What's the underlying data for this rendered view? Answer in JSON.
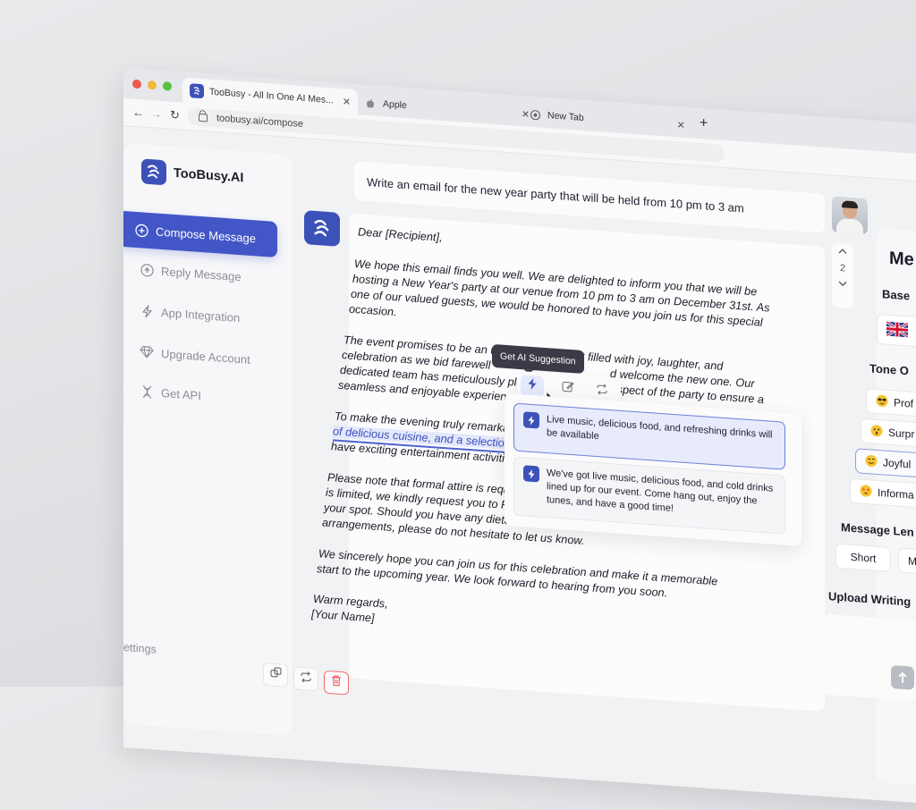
{
  "browser": {
    "tabs": [
      {
        "title": "TooBusy - All In One AI Mes...",
        "active": true
      },
      {
        "title": "Apple",
        "active": false
      },
      {
        "title": "New Tab",
        "active": false
      }
    ],
    "url": "toobusy.ai/compose"
  },
  "sidebar": {
    "brand": "TooBusy.AI",
    "items": [
      {
        "label": "Compose Message",
        "icon": "plus-circle-icon",
        "active": true
      },
      {
        "label": "Reply Message",
        "icon": "reply-icon",
        "active": false
      },
      {
        "label": "App Integration",
        "icon": "bolt-icon",
        "active": false
      },
      {
        "label": "Upgrade Account",
        "icon": "diamond-icon",
        "active": false
      },
      {
        "label": "Get API",
        "icon": "dna-icon",
        "active": false
      }
    ],
    "account_settings": "Account Settings"
  },
  "compose": {
    "prompt": "Write an email for the new year party that will be held from 10 pm to 3 am",
    "counter": "2",
    "letter": {
      "greeting": "Dear [Recipient],",
      "p1_l1": "We hope this email finds you well. We are delighted to inform you that we will be",
      "p1_l2": "hosting a New Year's party at our venue from 10 pm to 3 am on December 31st. As",
      "p1_l3": "one of our valued guests, we would be honored to have you join us for this special",
      "p1_l4": "occasion.",
      "p2_l1": "The event promises to be an unforgettable night filled with joy, laughter, and",
      "p2_l2": "celebration as we bid farewell",
      "p2_l2b": "d welcome the new one. Our",
      "p2_l3": "dedicated team has meticulously plan",
      "p2_l3b": "every aspect of the party to ensure a",
      "p2_l4": "seamless and enjoyable experience f",
      "p3_l1": "To make the evening truly remarkabl",
      "p3_l2": "of delicious cuisine, and a selection",
      "p3_l3": "have exciting entertainment activiti",
      "p4_l1": "Please note that formal attire is requ",
      "p4_l2": "is limited, we kindly request you to R",
      "p4_l3": "your spot. Should you have any dieta",
      "p4_l4": "arrangements, please do not hesitate to let us know.",
      "p5_l1": "We sincerely hope you can join us for this celebration and make it a memorable",
      "p5_l2": "start to the upcoming year. We look forward to hearing from you soon.",
      "closing": "Warm regards,",
      "signature": "[Your Name]"
    },
    "ai": {
      "tooltip": "Get AI Suggestion",
      "suggestions": [
        "Live music, delicious food, and refreshing drinks will be available",
        "We've got live music, delicious food, and cold drinks lined up for our event. Come hang out, enjoy the tunes, and have a good time!"
      ]
    }
  },
  "right_panel": {
    "title": "Me",
    "base_label": "Base",
    "tone_label": "Tone O",
    "tones": [
      {
        "label": "Prof",
        "emoji": "sunglasses-emoji",
        "selected": false
      },
      {
        "label": "Surpr",
        "emoji": "surprised-emoji",
        "selected": false
      },
      {
        "label": "Joyful",
        "emoji": "hugging-emoji",
        "selected": true
      },
      {
        "label": "Informa",
        "emoji": "star-eyes-emoji",
        "selected": false
      }
    ],
    "length_label": "Message Len",
    "lengths": [
      "Short",
      "Me"
    ],
    "upload_label": "Upload Writing"
  },
  "colors": {
    "accent": "#4256c7",
    "brand": "#3d52b8",
    "suggestion_bg": "#e7ebfb",
    "delete": "#ef6b6b"
  }
}
